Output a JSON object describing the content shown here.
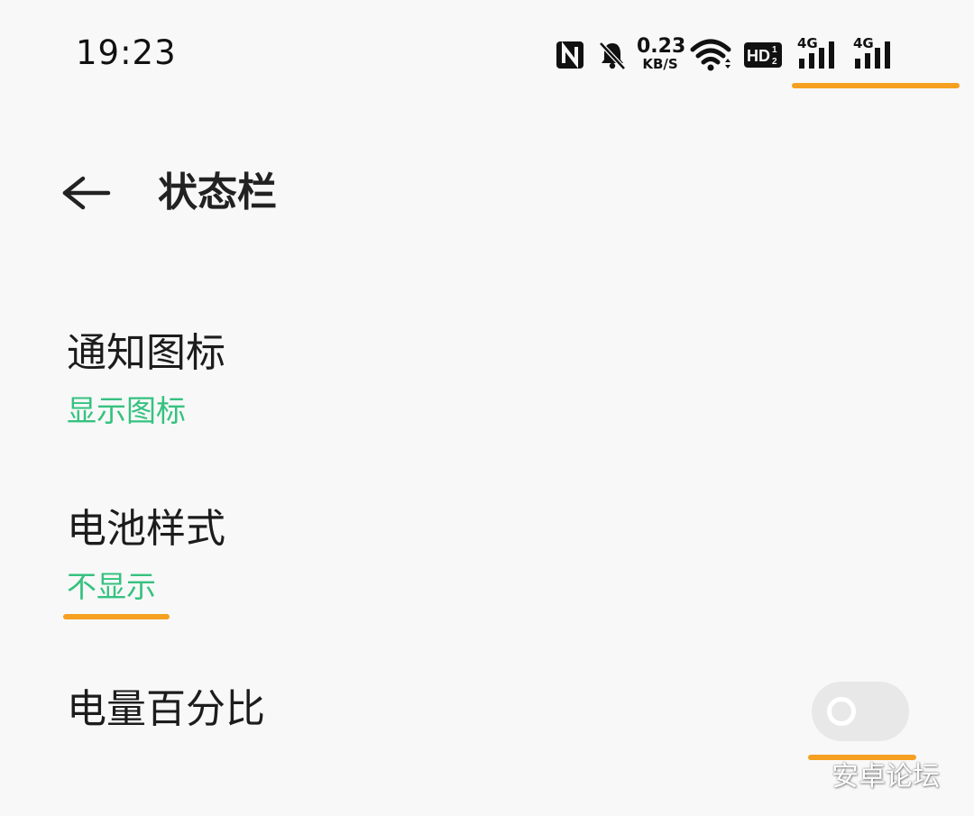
{
  "status_bar": {
    "time": "19:23",
    "net_speed_value": "0.23",
    "net_speed_unit": "KB/S",
    "hd_label": "HD",
    "hd_sub": "2",
    "hd_sup": "1",
    "sim1_type": "4G",
    "sim2_type": "4G",
    "icons": [
      "nfc-icon",
      "bell-muted-icon",
      "wifi-icon",
      "hd-voice-icon",
      "signal-icon",
      "signal-icon"
    ]
  },
  "header": {
    "title": "状态栏",
    "back_icon": "back-arrow-icon"
  },
  "settings": [
    {
      "title": "通知图标",
      "subtitle": "显示图标"
    },
    {
      "title": "电池样式",
      "subtitle": "不显示"
    },
    {
      "title": "电量百分比",
      "toggle_on": false
    }
  ],
  "watermark": "安卓论坛",
  "colors": {
    "accent": "#35c27f",
    "highlight": "#f5a020",
    "background": "#f8f8f8",
    "toggle_off": "#e8e8e8"
  }
}
